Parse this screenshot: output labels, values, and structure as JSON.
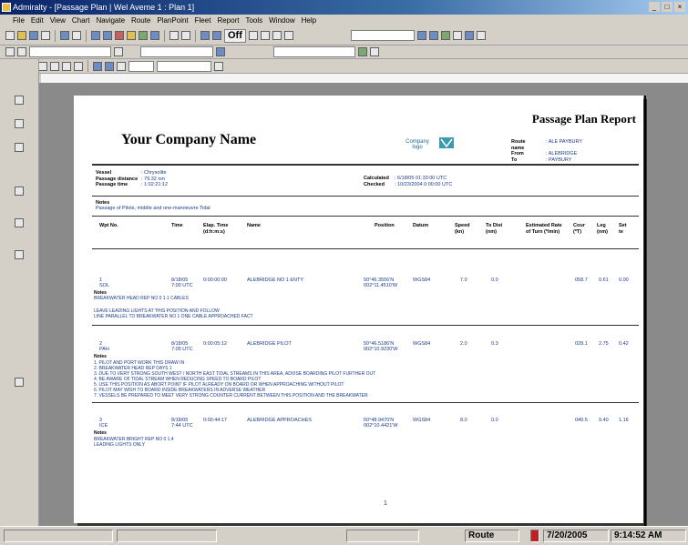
{
  "window": {
    "title": "Admiralty - [Passage Plan | Wel Aveme 1 : Plan 1]"
  },
  "menu": [
    "File",
    "Edit",
    "View",
    "Chart",
    "Navigate",
    "Route",
    "PlanPoint",
    "Fleet",
    "Report",
    "Tools",
    "Window",
    "Help"
  ],
  "toolbar": {
    "off_label": "Off"
  },
  "report": {
    "title": "Passage Plan Report",
    "company": "Your Company Name",
    "logo_text": "Company logo",
    "meta": [
      {
        "k": "Route name",
        "v": ": ALE PAYBURY"
      },
      {
        "k": "From",
        "v": ": ALEBRIDGE"
      },
      {
        "k": "To",
        "v": ": PAYBURY"
      }
    ],
    "vessel_block": [
      {
        "k": "Vessel",
        "v": ": Chrysolite"
      },
      {
        "k": "Passage distance",
        "v": ": 79.32 nm"
      },
      {
        "k": "Passage time",
        "v": ": 1:02:21:12"
      }
    ],
    "calc_block": [
      {
        "k": "Calculated",
        "v": ": 6/18/05 01:33:00 UTC"
      },
      {
        "k": "Checked",
        "v": ": 10/23/2004 0:00:00 UTC"
      }
    ],
    "notes_label": "Notes",
    "notes_text": "Passage of Pilots, middle and one-manoeuvre Tidal",
    "columns": [
      "Wpt No.",
      "Time",
      "Elap. Time (d:h:m:s)",
      "Name",
      "Position",
      "Datum",
      "Speed (kn)",
      "To Dist (nm)",
      "Estimated Rate of Turn (º/min)",
      "Cour (ºT)",
      "Leg (nm)",
      "Set te"
    ],
    "rows": [
      {
        "no": "1",
        "sub": "SOL",
        "time": "8/18/05",
        "time2": "7:00 UTC",
        "elap": "0:00:00:00",
        "name": "ALEBRIDGE NO 1 ENTY",
        "pos1": "50°46.3556'N",
        "pos2": "002°11.4510'W",
        "datum": "WGS84",
        "speed": "7.0",
        "dist": "0.0",
        "cour": "058.7",
        "leg": "0.61",
        "set": "0.00",
        "notes": [
          "BREAKWATER HEAD REP NO 0 1.1 CABLES",
          "",
          "LEAVE LEADING LIGHTS AT THIS POSITION AND FOLLOW",
          "LINE PARALLEL TO BREAKWATER NO 1 ONE CABLE APPROACHED FACT"
        ]
      },
      {
        "no": "2",
        "sub": "PAH",
        "time": "8/18/05",
        "time2": "7:05 UTC",
        "elap": "0:00:05:12",
        "name": "ALEBRIDGE PILOT",
        "pos1": "50°46.5186'N",
        "pos2": "002°10.9230'W",
        "datum": "WGS84",
        "speed": "2.0",
        "dist": "0.3",
        "cour": "028.1",
        "leg": "2.75",
        "set": "0.42",
        "notes": [
          "1. PILOT AND PORT WORK THIS DRAW IN",
          "2. BREAKWATER HEAD REP DAYS 1",
          "3. DUE TO VERY STRONG SOUTH WEST / NORTH EAST TIDAL STREAMS IN THIS AREA, ADVISE BOARDING PILOT FURTHER OUT",
          "4. BE AWARE OF TIDAL STREAM WHEN REDUCING SPEED TO BOARD PILOT",
          "5. USE THIS POSITION AS ABORT POINT IF PILOT ALREADY ON BOARD OR WHEN APPROACHING WITHOUT PILOT",
          "6. PILOT MAY WISH TO BOARD INSIDE BREAKWATERS IN ADVERSE WEATHER",
          "7. VESSELS BE PREPARED TO MEET VERY STRONG COUNTER CURRENT BETWEEN THIS POSITION AND THE BREAKWATER"
        ]
      },
      {
        "no": "3",
        "sub": "ICE",
        "time": "8/18/05",
        "time2": "7:44 UTC",
        "elap": "0:00:44:17",
        "name": "ALEBRIDGE APPROACHES",
        "pos1": "50°48.9470'N",
        "pos2": "002°10.4421'W",
        "datum": "WGS84",
        "speed": "8.0",
        "dist": "0.0",
        "cour": "040.5",
        "leg": "9.40",
        "set": "1.16",
        "notes": [
          "BREAKWATER BRIGHT REP NO 0 1.4",
          "LEADING LIGHTS ONLY"
        ]
      }
    ],
    "page_number": "1"
  },
  "status": {
    "mode": "Route",
    "date": "7/20/2005",
    "time": "9:14:52 AM"
  }
}
